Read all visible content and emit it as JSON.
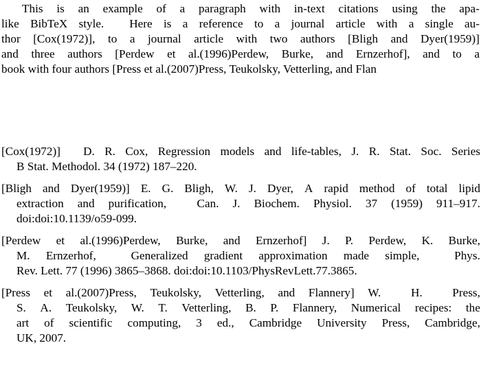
{
  "document": {
    "type": "latex-bibliography-output",
    "background_color": "#ffffff",
    "text_color": "#000000"
  },
  "paragraph": {
    "full_text": "This is an example of a paragraph with in-text citations using the apa-like BibTeX style. Here is a reference to a journal article with a single author [Cox(1972)], to a journal article with two authors [Bligh and Dyer(1959)] and three authors [Perdew et al.(1996)Perdew, Burke, and Ernzerhof], and to a book with four authors [Press et al.(2007)Press, Teukolsky, Vetterling, and Flan",
    "lines": [
      {
        "indent": true,
        "words": [
          "This",
          "is",
          "an",
          "example",
          "of",
          "a",
          "paragraph",
          "with",
          "in-text",
          "citations",
          "using",
          "the",
          "apa-"
        ]
      },
      {
        "indent": false,
        "words": [
          "like",
          "BibTeX",
          "style.",
          "",
          "Here",
          "is",
          "a",
          "reference",
          "to",
          "a",
          "journal",
          "article",
          "with",
          "a",
          "single",
          "au-"
        ]
      },
      {
        "indent": false,
        "words": [
          "thor",
          "[Cox(1972)],",
          "to",
          "a",
          "journal",
          "article",
          "with",
          "two",
          "authors",
          "[Bligh",
          "and",
          "Dyer(1959)]"
        ]
      },
      {
        "indent": false,
        "words": [
          "and",
          "three",
          "authors",
          "[Perdew",
          "et",
          "al.(1996)Perdew,",
          "Burke,",
          "and",
          "Ernzerhof],",
          "and",
          "to",
          "a"
        ]
      },
      {
        "indent": false,
        "clipped": true,
        "words": [
          "book",
          "with",
          "four",
          "authors",
          "[Press",
          "et",
          "al.(2007)Press,",
          "Teukolsky,",
          "Vetterling,",
          "and",
          "Flan"
        ]
      }
    ]
  },
  "bibliography": {
    "entries": [
      {
        "key": "[Cox(1972)]",
        "full_text": "[Cox(1972)] D. R. Cox, Regression models and life-tables, J. R. Stat. Soc. Series B Stat. Methodol. 34 (1972) 187–220.",
        "authors": "D. R. Cox",
        "title": "Regression models and life-tables",
        "journal": "J. R. Stat. Soc. Series B Stat. Methodol.",
        "volume": "34",
        "year": "1972",
        "pages": "187–220",
        "lines": [
          {
            "justify": true,
            "words": [
              "[Cox(1972)]",
              "",
              "D.",
              "R.",
              "Cox,",
              "Regression",
              "models",
              "and",
              "life-tables,",
              "J.",
              "R.",
              "Stat.",
              "Soc.",
              "Series"
            ]
          },
          {
            "justify": false,
            "words": [
              "B Stat. Methodol. 34 (1972) 187–220."
            ]
          }
        ]
      },
      {
        "key": "[Bligh and Dyer(1959)]",
        "full_text": "[Bligh and Dyer(1959)] E. G. Bligh, W. J. Dyer, A rapid method of total lipid extraction and purification, Can. J. Biochem. Physiol. 37 (1959) 911–917. doi:doi:10.1139/o59-099.",
        "authors": "E. G. Bligh, W. J. Dyer",
        "title": "A rapid method of total lipid extraction and purification",
        "journal": "Can. J. Biochem. Physiol.",
        "volume": "37",
        "year": "1959",
        "pages": "911–917",
        "doi": "doi:doi:10.1139/o59-099.",
        "lines": [
          {
            "justify": true,
            "words": [
              "[Bligh",
              "and",
              "Dyer(1959)]",
              "E.",
              "G.",
              "Bligh,",
              "W.",
              "J.",
              "Dyer,",
              "A",
              "rapid",
              "method",
              "of",
              "total",
              "lipid"
            ]
          },
          {
            "justify": true,
            "words": [
              "extraction",
              "and",
              "purification,",
              "",
              "Can.",
              "J.",
              "Biochem.",
              "Physiol.",
              "37",
              "(1959)",
              "911–917."
            ]
          },
          {
            "justify": false,
            "words": [
              "doi:doi:10.1139/o59-099."
            ]
          }
        ]
      },
      {
        "key": "[Perdew et al.(1996)Perdew, Burke, and Ernzerhof]",
        "full_text": "[Perdew et al.(1996)Perdew, Burke, and Ernzerhof] J. P. Perdew, K. Burke, M. Ernzerhof, Generalized gradient approximation made simple, Phys. Rev. Lett. 77 (1996) 3865–3868. doi:doi:10.1103/PhysRevLett.77.3865.",
        "authors": "J. P. Perdew, K. Burke, M. Ernzerhof",
        "title": "Generalized gradient approximation made simple",
        "journal": "Phys. Rev. Lett.",
        "volume": "77",
        "year": "1996",
        "pages": "3865–3868",
        "doi": "doi:doi:10.1103/PhysRevLett.77.3865.",
        "lines": [
          {
            "justify": true,
            "words": [
              "[Perdew",
              "et",
              "al.(1996)Perdew,",
              "Burke,",
              "and",
              "Ernzerhof]",
              "J.",
              "P.",
              "Perdew,",
              "K.",
              "Burke,"
            ]
          },
          {
            "justify": true,
            "words": [
              "M.",
              "Ernzerhof,",
              "",
              "Generalized",
              "gradient",
              "approximation",
              "made",
              "simple,",
              "",
              "Phys."
            ]
          },
          {
            "justify": false,
            "words": [
              "Rev. Lett. 77 (1996) 3865–3868. doi:doi:10.1103/PhysRevLett.77.3865."
            ]
          }
        ]
      },
      {
        "key": "[Press et al.(2007)Press, Teukolsky, Vetterling, and Flannery]",
        "full_text": "[Press et al.(2007)Press, Teukolsky, Vetterling, and Flannery] W. H. Press, S. A. Teukolsky, W. T. Vetterling, B. P. Flannery, Numerical recipes: the art of scientific computing, 3 ed., Cambridge University Press, Cambridge, UK, 2007.",
        "authors": "W. H. Press, S. A. Teukolsky, W. T. Vetterling, B. P. Flannery",
        "title": "Numerical recipes: the art of scientific computing",
        "edition": "3 ed.",
        "publisher": "Cambridge University Press",
        "address": "Cambridge, UK",
        "year": "2007",
        "lines": [
          {
            "justify": true,
            "words": [
              "[Press",
              "et",
              "al.(2007)Press,",
              "Teukolsky,",
              "Vetterling,",
              "and",
              "Flannery]",
              "W.",
              "",
              "H.",
              "",
              "Press,"
            ]
          },
          {
            "justify": true,
            "words": [
              "S.",
              "A.",
              "Teukolsky,",
              "W.",
              "T.",
              "Vetterling,",
              "B.",
              "P.",
              "Flannery,",
              "Numerical",
              "recipes:",
              "the"
            ]
          },
          {
            "justify": true,
            "words": [
              "art",
              "of",
              "scientific",
              "computing,",
              "3",
              "ed.,",
              "Cambridge",
              "University",
              "Press,",
              "Cambridge,"
            ]
          },
          {
            "justify": false,
            "words": [
              "UK, 2007."
            ]
          }
        ]
      }
    ]
  }
}
